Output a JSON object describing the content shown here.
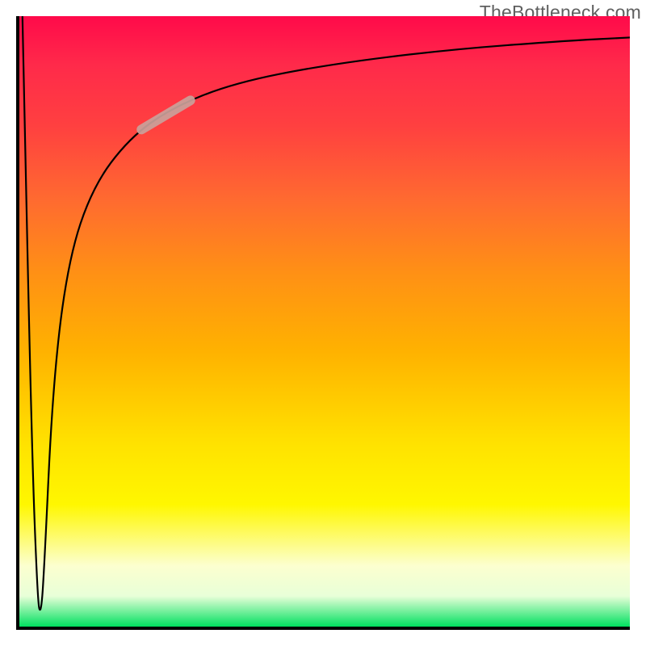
{
  "watermark": "TheBottleneck.com",
  "colors": {
    "border": "#000000",
    "curve": "#000000",
    "highlight": "#caa19a",
    "gradient_top": "#ff0a4a",
    "gradient_bottom": "#00e060"
  },
  "chart_data": {
    "type": "line",
    "title": "",
    "xlabel": "",
    "ylabel": "",
    "xlim": [
      0,
      100
    ],
    "ylim": [
      0,
      100
    ],
    "grid": false,
    "legend": false,
    "series": [
      {
        "name": "curve",
        "x": [
          0.5,
          2,
          3,
          3.5,
          4,
          5.5,
          8,
          12,
          18,
          25,
          35,
          50,
          70,
          90,
          100
        ],
        "values": [
          100,
          30,
          4,
          2,
          8,
          40,
          60,
          72,
          80,
          85,
          89,
          92,
          94.5,
          96,
          96.5
        ]
      }
    ],
    "annotations": [
      {
        "type": "segment_highlight",
        "x_start": 20,
        "x_end": 28,
        "note": "highlighted region on curve"
      }
    ]
  }
}
